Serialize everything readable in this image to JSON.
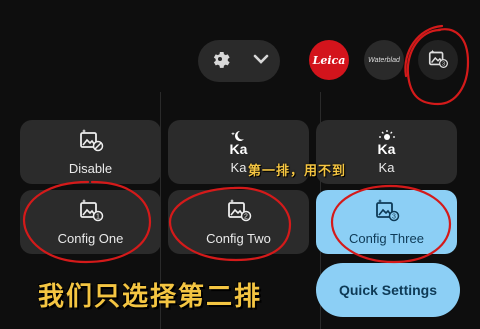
{
  "toolbar": {
    "settings_icon": "gear-icon",
    "chevron_icon": "chevron-down-icon",
    "leica_label": "Leica",
    "hasselblad_label": "Waterblad",
    "config_icon": "config-3-icon"
  },
  "tiles": {
    "row1": [
      {
        "label": "Disable",
        "icon": "disable-icon"
      },
      {
        "label": "Ka",
        "icon": "night-ka-icon"
      },
      {
        "label": "Ka",
        "icon": "sun-ka-icon"
      }
    ],
    "row2": [
      {
        "label": "Config One",
        "icon": "config-1-icon"
      },
      {
        "label": "Config Two",
        "icon": "config-2-icon"
      },
      {
        "label": "Config Three",
        "icon": "config-3-icon",
        "active": true
      }
    ]
  },
  "quick_settings": {
    "label": "Quick Settings"
  },
  "captions": {
    "row1_note": "第一排，用不到",
    "row2_note": "我们只选择第二排"
  },
  "colors": {
    "accent": "#8ccff5",
    "leica_red": "#d3141c",
    "caption_yellow": "#f4c542",
    "annotation_red": "#d41a1a"
  }
}
